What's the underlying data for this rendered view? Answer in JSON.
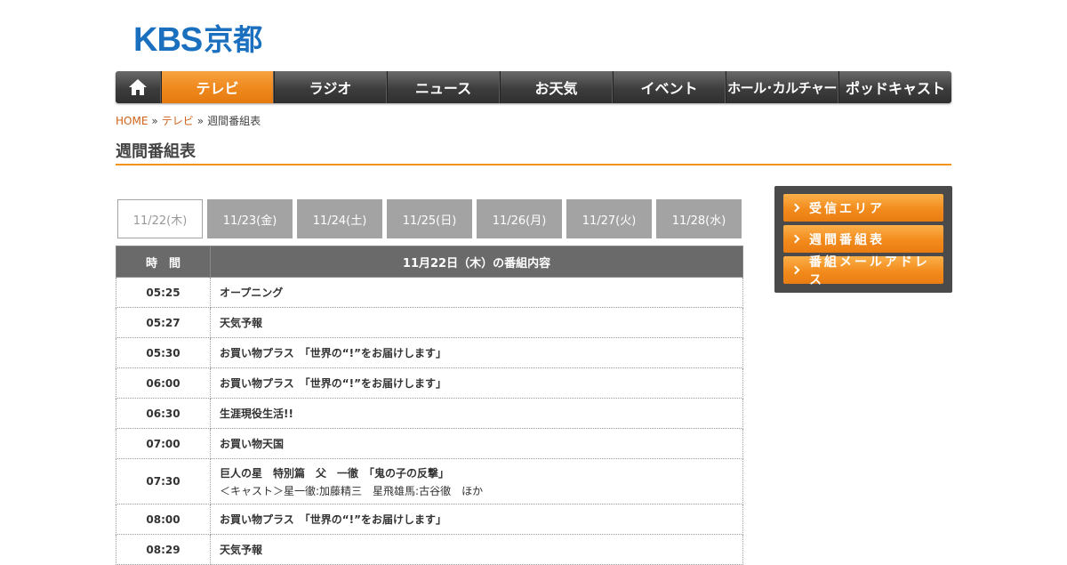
{
  "logo": {
    "latin": "KBS",
    "kanji": "京都"
  },
  "nav": {
    "items": [
      "テレビ",
      "ラジオ",
      "ニュース",
      "お天気",
      "イベント",
      "ホール･カルチャー",
      "ポッドキャスト"
    ],
    "active": "テレビ"
  },
  "breadcrumb": {
    "home": "HOME",
    "sep": "»",
    "tv": "テレビ",
    "current": "週間番組表"
  },
  "page_title": "週間番組表",
  "date_tabs": [
    "11/22(木)",
    "11/23(金)",
    "11/24(土)",
    "11/25(日)",
    "11/26(月)",
    "11/27(火)",
    "11/28(水)"
  ],
  "schedule": {
    "header_time": "時　間",
    "header_program": "11月22日（木）の番組内容",
    "rows": [
      {
        "time": "05:25",
        "title": "オープニング",
        "cast": ""
      },
      {
        "time": "05:27",
        "title": "天気予報",
        "cast": ""
      },
      {
        "time": "05:30",
        "title": "お買い物プラス　「世界の“!”をお届けします」",
        "cast": ""
      },
      {
        "time": "06:00",
        "title": "お買い物プラス　「世界の“!”をお届けします」",
        "cast": ""
      },
      {
        "time": "06:30",
        "title": "生涯現役生活!!",
        "cast": ""
      },
      {
        "time": "07:00",
        "title": "お買い物天国",
        "cast": ""
      },
      {
        "time": "07:30",
        "title": "巨人の星　特別篇　父　一徹　「鬼の子の反撃」",
        "cast": "＜キャスト＞星一徹:加藤精三　星飛雄馬:古谷徹　ほか"
      },
      {
        "time": "08:00",
        "title": "お買い物プラス　「世界の“!”をお届けします」",
        "cast": ""
      },
      {
        "time": "08:29",
        "title": "天気予報",
        "cast": ""
      }
    ]
  },
  "sidebar": {
    "buttons": [
      "受信エリア",
      "週間番組表",
      "番組メールアドレス"
    ]
  },
  "colors": {
    "accent_orange": "#f0941c",
    "logo_blue": "#1a6fbf",
    "nav_dark": "#3d3d3d"
  }
}
